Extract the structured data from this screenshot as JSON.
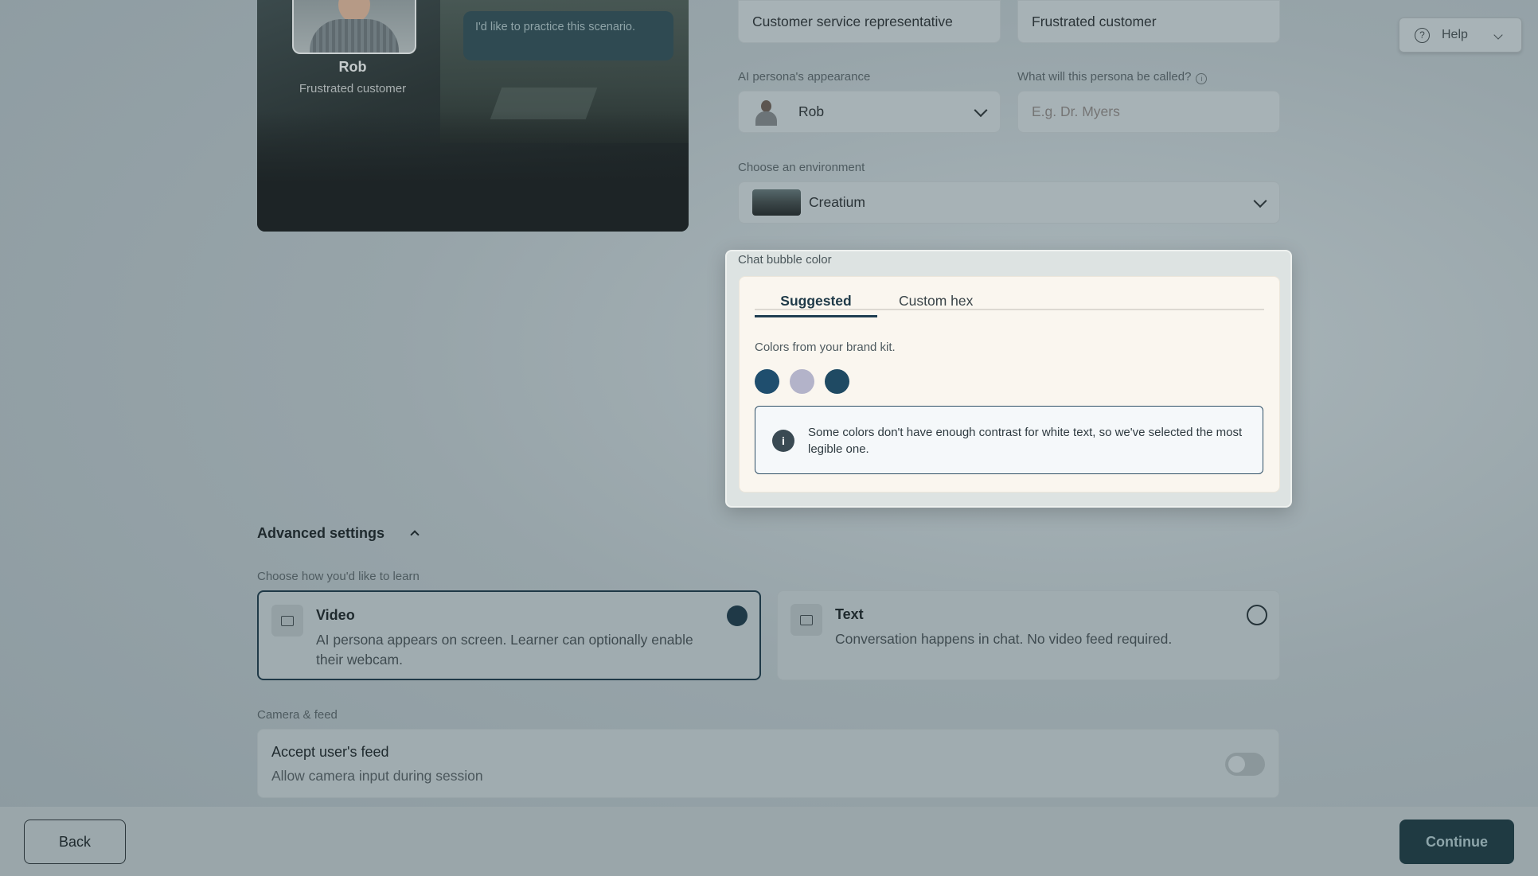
{
  "preview": {
    "persona_name": "Rob",
    "persona_role": "Frustrated customer",
    "speech_text": "I'd like to practice this scenario."
  },
  "roles": {
    "learner_role_value": "Customer service representative",
    "ai_role_value": "Frustrated customer"
  },
  "appearance": {
    "label": "AI persona's appearance",
    "selected": "Rob"
  },
  "persona_called": {
    "label": "What will this persona be called?",
    "placeholder": "E.g. Dr. Myers"
  },
  "environment": {
    "label": "Choose an environment",
    "selected": "Creatium"
  },
  "help": {
    "label": "Help"
  },
  "chat_bubble": {
    "label": "Chat bubble color",
    "tabs": {
      "suggested": "Suggested",
      "custom": "Custom hex"
    },
    "brand_note": "Colors from your brand kit.",
    "swatches": [
      "#1f4e6e",
      "#b3b3c9",
      "#1f4a63"
    ],
    "notice": "Some colors don't have enough contrast for white text, so we've selected the most legible one."
  },
  "advanced": {
    "title": "Advanced settings",
    "learn_label": "Choose how you'd like to learn",
    "video": {
      "title": "Video",
      "desc": "AI persona appears on screen. Learner can optionally enable their webcam.",
      "selected": true
    },
    "text": {
      "title": "Text",
      "desc": "Conversation happens in chat. No video feed required.",
      "selected": false
    },
    "camera_label": "Camera & feed",
    "feed_title": "Accept user's feed",
    "feed_desc": "Allow camera input during session",
    "feed_enabled": false
  },
  "footer": {
    "back": "Back",
    "continue": "Continue"
  }
}
